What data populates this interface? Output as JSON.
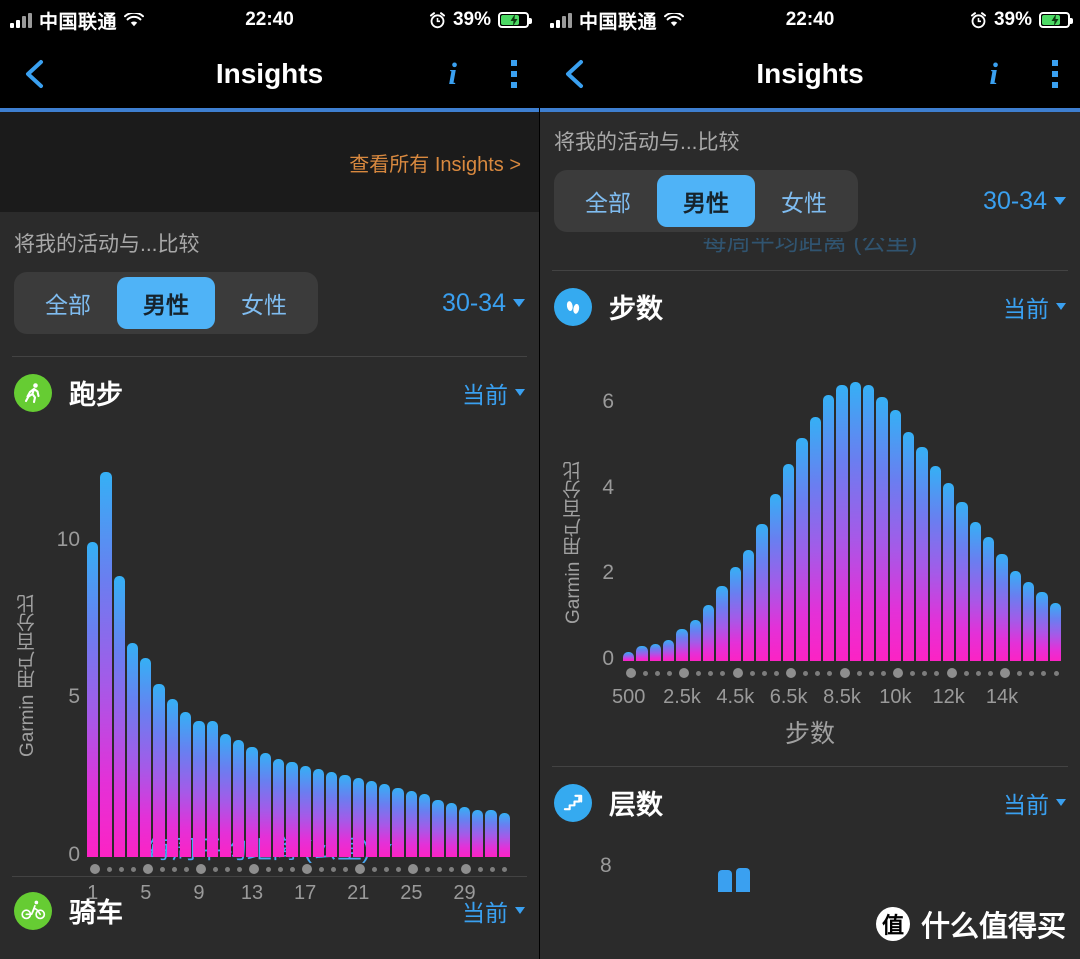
{
  "statusbar": {
    "carrier": "中国联通",
    "time": "22:40",
    "battery_pct": "39%",
    "signal_icon": "cell-signal-icon",
    "wifi_icon": "wifi-icon",
    "alarm_icon": "alarm-clock-icon",
    "battery_icon": "battery-charging-icon"
  },
  "navbar": {
    "back_icon": "back-chevron-icon",
    "title": "Insights",
    "info_icon": "info-italic-icon",
    "overflow_icon": "kebab-menu-icon",
    "info_label": "i"
  },
  "left": {
    "banner": {
      "see_all": "查看所有 Insights >"
    },
    "compare": {
      "label": "将我的活动与...比较",
      "segments": [
        {
          "label": "全部",
          "active": false
        },
        {
          "label": "男性",
          "active": true
        },
        {
          "label": "女性",
          "active": false
        }
      ],
      "age": "30-34",
      "age_caret_icon": "chevron-down-icon"
    },
    "activity": {
      "icon": "running-person-icon",
      "title": "跑步",
      "when": "当前",
      "when_caret_icon": "chevron-down-icon"
    },
    "footer": {
      "metric": "每周平均距离 (公里)",
      "caret_icon": "chevron-down-icon"
    },
    "next_activity": {
      "icon": "cycling-person-icon",
      "title": "骑车",
      "when": "当前",
      "when_caret_icon": "chevron-down-icon"
    }
  },
  "right": {
    "compare": {
      "label": "将我的活动与...比较",
      "segments": [
        {
          "label": "全部",
          "active": false
        },
        {
          "label": "男性",
          "active": true
        },
        {
          "label": "女性",
          "active": false
        }
      ],
      "age": "30-34",
      "age_caret_icon": "chevron-down-icon"
    },
    "ghost_text": "每周平均距离 (公里)",
    "activity": {
      "icon": "footsteps-icon",
      "title": "步数",
      "when": "当前",
      "when_caret_icon": "chevron-down-icon"
    },
    "caption": "步数",
    "next_activity": {
      "icon": "stairs-arrow-icon",
      "title": "层数",
      "when": "当前",
      "when_caret_icon": "chevron-down-icon"
    },
    "partial_ytick": "8"
  },
  "watermark": {
    "badge": "值",
    "text": "什么值得买"
  },
  "colors": {
    "accent_blue": "#3aa0f0",
    "selected_segment": "#4fb3f7",
    "orange_link": "#d9893f",
    "bar_top": "#35b0f5",
    "bar_mid": "#a55ae8",
    "bar_bottom": "#fc23c4",
    "green_badge": "#66cc33",
    "blue_badge": "#35aaf0",
    "page_bg": "#2b2b2b",
    "bar_bg": "#000000"
  },
  "chart_data": [
    {
      "type": "bar",
      "title": "跑步 — 每周平均距离 (公里)",
      "ylabel": "Garmin 用户百分比",
      "xlabel": "每周平均距离 (公里)",
      "ylim": [
        0,
        13
      ],
      "yticks": [
        0,
        5,
        10
      ],
      "ytick_labels": [
        "0",
        "5",
        "10"
      ],
      "grid": false,
      "legend": null,
      "xtick_positions": [
        1,
        5,
        9,
        13,
        17,
        21,
        25,
        29
      ],
      "xtick_labels": [
        "1",
        "5",
        "9",
        "13",
        "17",
        "21",
        "25",
        "29"
      ],
      "categories": [
        1,
        2,
        3,
        4,
        5,
        6,
        7,
        8,
        9,
        10,
        11,
        12,
        13,
        14,
        15,
        16,
        17,
        18,
        19,
        20,
        21,
        22,
        23,
        24,
        25,
        26,
        27,
        28,
        29,
        30,
        31,
        32
      ],
      "values": [
        10.0,
        12.2,
        8.9,
        6.8,
        6.3,
        5.5,
        5.0,
        4.6,
        4.3,
        4.3,
        3.9,
        3.7,
        3.5,
        3.3,
        3.1,
        3.0,
        2.9,
        2.8,
        2.7,
        2.6,
        2.5,
        2.4,
        2.3,
        2.2,
        2.1,
        2.0,
        1.8,
        1.7,
        1.6,
        1.5,
        1.5,
        1.4
      ]
    },
    {
      "type": "bar",
      "title": "步数",
      "ylabel": "Garmin 用户百分比",
      "xlabel": "步数",
      "ylim": [
        0,
        7
      ],
      "yticks": [
        0,
        2,
        4,
        6
      ],
      "ytick_labels": [
        "0",
        "2",
        "4",
        "6"
      ],
      "grid": false,
      "legend": null,
      "xtick_positions": [
        1,
        5,
        9,
        13,
        17,
        21,
        25,
        29
      ],
      "xtick_labels": [
        "500",
        "2.5k",
        "4.5k",
        "6.5k",
        "8.5k",
        "10k",
        "12k",
        "14k"
      ],
      "categories": [
        "500",
        "1k",
        "1.5k",
        "2k",
        "2.5k",
        "3k",
        "3.5k",
        "4k",
        "4.5k",
        "5k",
        "5.5k",
        "6k",
        "6.5k",
        "7k",
        "7.5k",
        "8k",
        "8.5k",
        "9k",
        "9.5k",
        "10k",
        "10.5k",
        "11k",
        "11.5k",
        "12k",
        "12.5k",
        "13k",
        "13.5k",
        "14k",
        "14.5k",
        "15k",
        "15.5k",
        "16k",
        "16.5k"
      ],
      "values": [
        0.2,
        0.35,
        0.4,
        0.5,
        0.75,
        0.95,
        1.3,
        1.75,
        2.2,
        2.6,
        3.2,
        3.9,
        4.6,
        5.2,
        5.7,
        6.2,
        6.45,
        6.5,
        6.45,
        6.15,
        5.85,
        5.35,
        5.0,
        4.55,
        4.15,
        3.7,
        3.25,
        2.9,
        2.5,
        2.1,
        1.85,
        1.6,
        1.35
      ]
    }
  ]
}
